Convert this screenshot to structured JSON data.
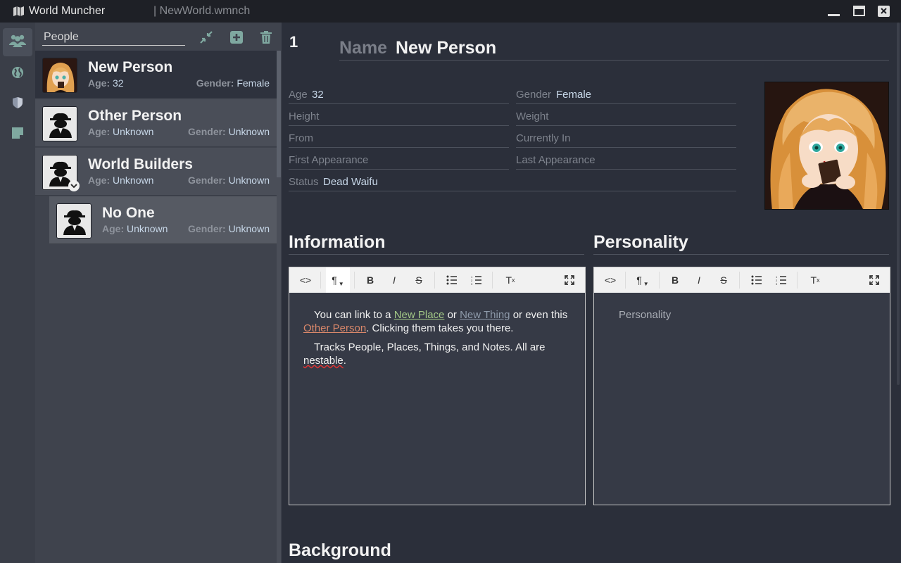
{
  "window": {
    "app_title": "World Muncher",
    "file_name": "| NewWorld.wmnch"
  },
  "rail": {
    "items": [
      {
        "icon": "people-icon",
        "active": true
      },
      {
        "icon": "globe-icon",
        "active": false
      },
      {
        "icon": "shield-icon",
        "active": false
      },
      {
        "icon": "note-icon",
        "active": false
      }
    ]
  },
  "list": {
    "search_value": "People",
    "entries": [
      {
        "name": "New Person",
        "age_label": "Age:",
        "age": "32",
        "gender_label": "Gender:",
        "gender": "Female"
      },
      {
        "name": "Other Person",
        "age_label": "Age:",
        "age": "Unknown",
        "gender_label": "Gender:",
        "gender": "Unknown"
      },
      {
        "name": "World Builders",
        "age_label": "Age:",
        "age": "Unknown",
        "gender_label": "Gender:",
        "gender": "Unknown"
      },
      {
        "name": "No One",
        "age_label": "Age:",
        "age": "Unknown",
        "gender_label": "Gender:",
        "gender": "Unknown"
      }
    ]
  },
  "detail": {
    "id": "1",
    "name_label": "Name",
    "name_value": "New Person",
    "fields": {
      "age_label": "Age",
      "age_value": "32",
      "gender_label": "Gender",
      "gender_value": "Female",
      "height_label": "Height",
      "height_value": "",
      "weight_label": "Weight",
      "weight_value": "",
      "from_label": "From",
      "from_value": "",
      "currently_in_label": "Currently In",
      "currently_in_value": "",
      "first_appearance_label": "First Appearance",
      "first_appearance_value": "",
      "last_appearance_label": "Last Appearance",
      "last_appearance_value": "",
      "status_label": "Status",
      "status_value": "Dead Waifu"
    },
    "information": {
      "title": "Information",
      "p1_a": "You can link to a ",
      "link_place": "New Place",
      "p1_b": " or ",
      "link_thing": "New Thing",
      "p1_c": " or even this ",
      "link_person": "Other Person",
      "p1_d": ". Clicking them takes you there.",
      "p2_a": "Tracks People, Places, Things, and Notes. All are ",
      "p2_b": "nestable",
      "p2_c": "."
    },
    "personality": {
      "title": "Personality",
      "placeholder": "Personality"
    },
    "background": {
      "title": "Background"
    }
  },
  "toolbar": {
    "code": "<>",
    "paragraph": "¶",
    "bold": "B",
    "italic": "I",
    "strike": "S",
    "clear": "Tx"
  },
  "colors": {
    "link_place": "#a3c987",
    "link_thing": "#8e9aaa",
    "link_person": "#d9876a",
    "rail_icon": "#7fa8a0"
  }
}
